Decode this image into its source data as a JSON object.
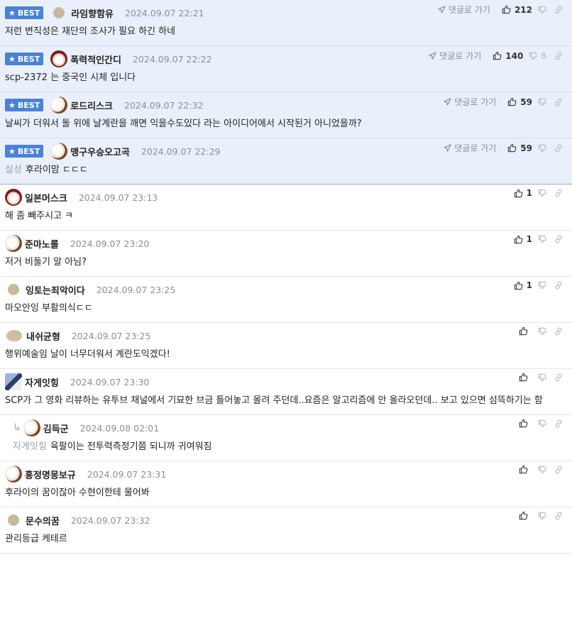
{
  "labels": {
    "best": "BEST",
    "reply_go": "댓글로 가기"
  },
  "comments": [
    {
      "best": true,
      "avatar": "dot",
      "nick": "라임향함유",
      "time": "2024.09.07 22:21",
      "likes": "212",
      "dislikes": "",
      "text": "저런 변직성은 재단의 조사가 필요 하긴 하네",
      "mention": ""
    },
    {
      "best": true,
      "avatar": "red",
      "nick": "폭력적인간디",
      "time": "2024.09.07 22:22",
      "likes": "140",
      "dislikes": "8",
      "text": "scp-2372 는 중국인 시체 입니다",
      "mention": ""
    },
    {
      "best": true,
      "avatar": "dog",
      "nick": "로드리스크",
      "time": "2024.09.07 22:32",
      "likes": "59",
      "dislikes": "",
      "text": "날씨가 더워서 돌 위에 날계란을 깨면 익을수도있다 라는 아이디어에서 시작된거 아니었을까?",
      "mention": ""
    },
    {
      "best": true,
      "avatar": "dog",
      "nick": "맹구우승오고곡",
      "time": "2024.09.07 22:29",
      "likes": "59",
      "dislikes": "",
      "text": "후라이맘 ㄷㄷㄷ",
      "mention": "실성"
    },
    {
      "best": false,
      "avatar": "red",
      "nick": "일본머스크",
      "time": "2024.09.07 23:13",
      "likes": "1",
      "dislikes": "",
      "text": "해 좀 빼주시고 ㅋ",
      "mention": ""
    },
    {
      "best": false,
      "avatar": "dog",
      "nick": "준마노롤",
      "time": "2024.09.07 23:20",
      "likes": "1",
      "dislikes": "",
      "text": "저거 비둘기 알 아님?",
      "mention": ""
    },
    {
      "best": false,
      "avatar": "dot",
      "nick": "잉토는죄악이다",
      "time": "2024.09.07 23:25",
      "likes": "1",
      "dislikes": "",
      "text": "마오안잉 부활의식ㄷㄷ",
      "mention": ""
    },
    {
      "best": false,
      "avatar": "blob",
      "nick": "내쉬균형",
      "time": "2024.09.07 23:25",
      "likes": "",
      "dislikes": "",
      "text": "행위예술임 날이 너무더워서 계란도익겠다!",
      "mention": ""
    },
    {
      "best": false,
      "avatar": "mask",
      "nick": "자게잇힝",
      "time": "2024.09.07 23:30",
      "likes": "",
      "dislikes": "",
      "text": "SCP가 그 영화 리뷰하는 유투브 채널에서 기묘한 브금 틀어놓고 올려 주던데..요즘은 알고리즘에 안 올라오던데.. 보고 있으면 섬뜩하기는 함",
      "mention": ""
    },
    {
      "best": false,
      "reply": true,
      "avatar": "dog",
      "nick": "김득군",
      "time": "2024.09.08 02:01",
      "likes": "",
      "dislikes": "",
      "text": "육팔이는 전투력측정기쯤 되니까 귀여워짐",
      "mention": "자게잇힝"
    },
    {
      "best": false,
      "avatar": "dog",
      "nick": "홍정명몽보규",
      "time": "2024.09.07 23:31",
      "likes": "",
      "dislikes": "",
      "text": "후라이의 꿈이잖아 수현이한테 물어봐",
      "mention": ""
    },
    {
      "best": false,
      "avatar": "dot",
      "nick": "문수의꿈",
      "time": "2024.09.07 23:32",
      "likes": "",
      "dislikes": "",
      "text": "관리등급 케테르",
      "mention": ""
    }
  ]
}
